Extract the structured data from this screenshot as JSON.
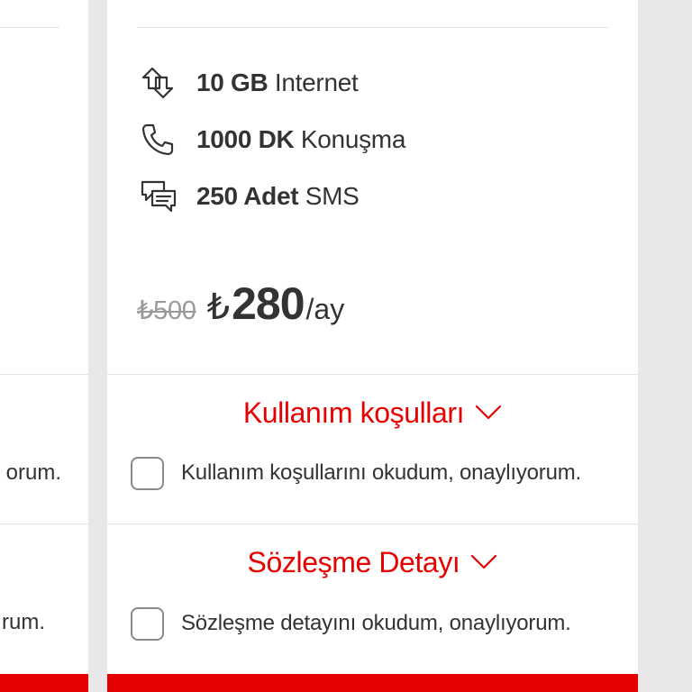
{
  "features": [
    {
      "amount": "10 GB",
      "label": "Internet",
      "icon": "data-arrows-icon"
    },
    {
      "amount": "1000 DK",
      "label": "Konuşma",
      "icon": "phone-icon"
    },
    {
      "amount": "250 Adet",
      "label": "SMS",
      "icon": "sms-chat-icon"
    }
  ],
  "price": {
    "old": "₺500",
    "currency": "₺",
    "amount": "280",
    "period": "/ay"
  },
  "terms": {
    "title": "Kullanım koşulları",
    "checkbox_label": "Kullanım koşullarını okudum, onaylıyorum.",
    "left_partial": "orum."
  },
  "contract": {
    "title": "Sözleşme Detayı",
    "checkbox_label": "Sözleşme detayını okudum, onaylıyorum.",
    "left_partial": "rum."
  },
  "colors": {
    "accent": "#e60000",
    "background": "#e8e8e8",
    "card": "#ffffff",
    "text": "#333333",
    "muted": "#9a9a9a"
  }
}
